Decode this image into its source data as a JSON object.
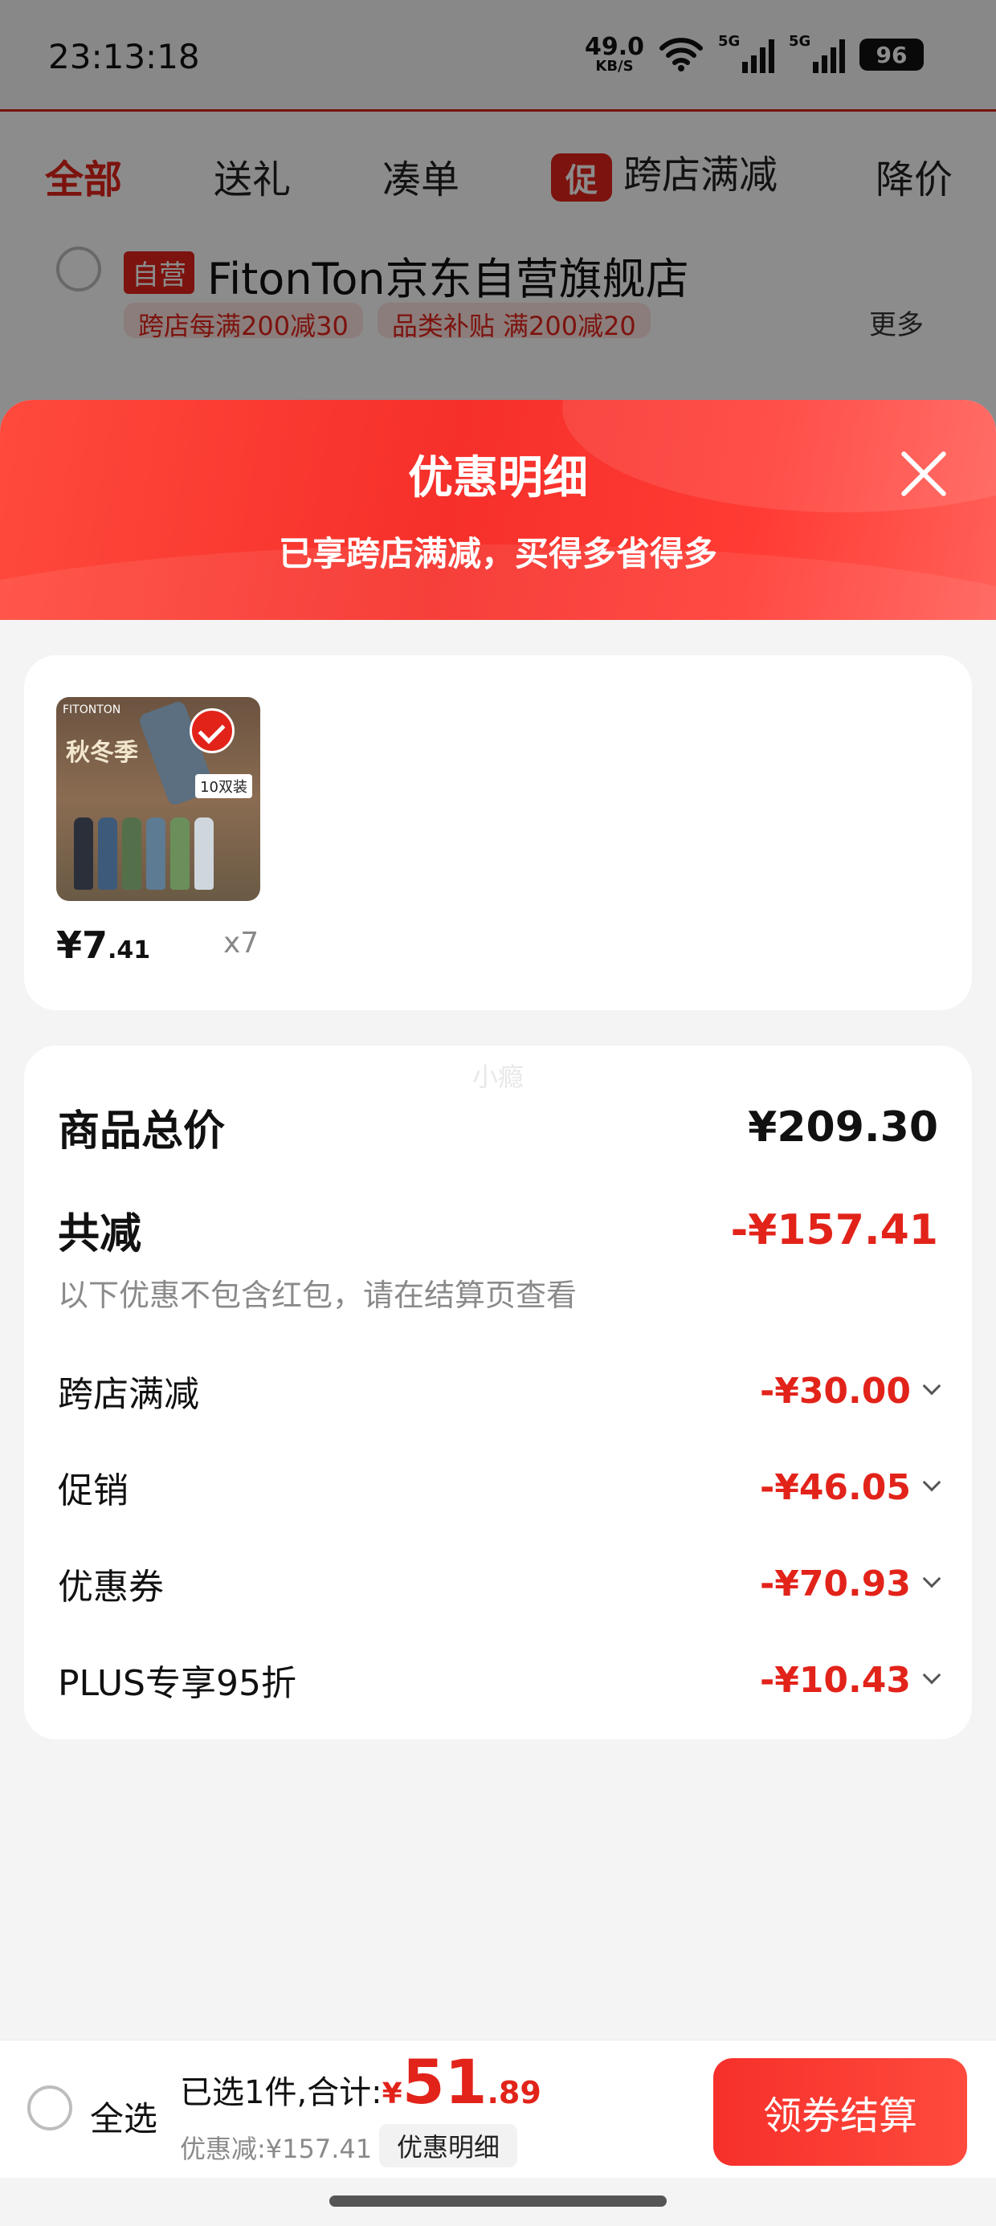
{
  "status_bar": {
    "time": "23:13:18",
    "net_speed_value": "49.0",
    "net_speed_unit": "KB/S",
    "signal_1_tag": "5G",
    "signal_2_tag": "5G",
    "battery": "96"
  },
  "tabs": [
    {
      "label": "全部",
      "active": true
    },
    {
      "label": "送礼"
    },
    {
      "label": "凑单"
    },
    {
      "label": "跨店满减",
      "badge": "促"
    },
    {
      "label": "降价"
    }
  ],
  "shop": {
    "tag": "自营",
    "name": "FitonTon京东自营旗舰店",
    "promos": [
      "跨店每满200减30",
      "品类补贴 满200减20"
    ],
    "more": "更多"
  },
  "sheet": {
    "title": "优惠明细",
    "subtitle": "已享跨店满减，买得多省得多"
  },
  "item": {
    "thumb_brand": "FITONTON",
    "thumb_text": "秋冬季",
    "thumb_pairs": "10双装",
    "price_main": "¥7",
    "price_decimal": ".41",
    "qty": "x7"
  },
  "summary": {
    "watermark": "小瘾",
    "total_label": "商品总价",
    "total_value": "¥209.30",
    "reduce_label": "共减",
    "reduce_value": "-¥157.41",
    "note": "以下优惠不包含红包，请在结算页查看",
    "items": [
      {
        "label": "跨店满减",
        "value": "-¥30.00"
      },
      {
        "label": "促销",
        "value": "-¥46.05"
      },
      {
        "label": "优惠券",
        "value": "-¥70.93"
      },
      {
        "label": "PLUS专享95折",
        "value": "-¥10.43"
      }
    ]
  },
  "bottom": {
    "select_all": "全选",
    "selected_text": "已选1件,合计:",
    "yen": "¥",
    "total_main": "51",
    "total_decimal": ".89",
    "discount_text": "优惠减:¥157.41",
    "detail_button": "优惠明细",
    "checkout_button": "领券结算"
  },
  "colors": {
    "accent": "#e2231a",
    "header_red": "#f62f2a"
  }
}
